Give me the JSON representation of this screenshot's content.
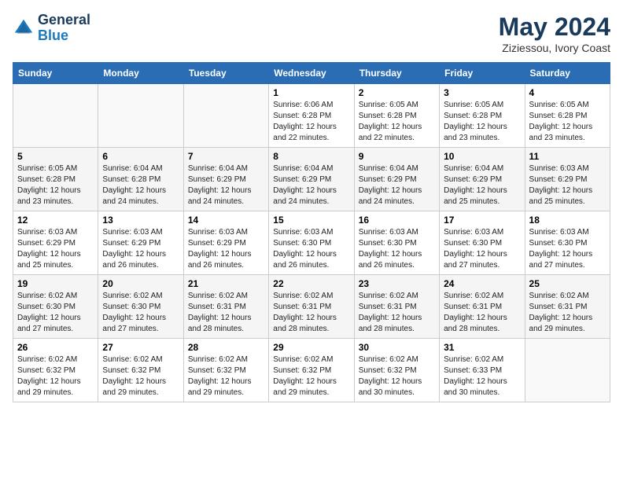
{
  "header": {
    "logo_line1": "General",
    "logo_line2": "Blue",
    "month": "May 2024",
    "location": "Ziziessou, Ivory Coast"
  },
  "weekdays": [
    "Sunday",
    "Monday",
    "Tuesday",
    "Wednesday",
    "Thursday",
    "Friday",
    "Saturday"
  ],
  "weeks": [
    [
      {
        "day": "",
        "info": ""
      },
      {
        "day": "",
        "info": ""
      },
      {
        "day": "",
        "info": ""
      },
      {
        "day": "1",
        "info": "Sunrise: 6:06 AM\nSunset: 6:28 PM\nDaylight: 12 hours\nand 22 minutes."
      },
      {
        "day": "2",
        "info": "Sunrise: 6:05 AM\nSunset: 6:28 PM\nDaylight: 12 hours\nand 22 minutes."
      },
      {
        "day": "3",
        "info": "Sunrise: 6:05 AM\nSunset: 6:28 PM\nDaylight: 12 hours\nand 23 minutes."
      },
      {
        "day": "4",
        "info": "Sunrise: 6:05 AM\nSunset: 6:28 PM\nDaylight: 12 hours\nand 23 minutes."
      }
    ],
    [
      {
        "day": "5",
        "info": "Sunrise: 6:05 AM\nSunset: 6:28 PM\nDaylight: 12 hours\nand 23 minutes."
      },
      {
        "day": "6",
        "info": "Sunrise: 6:04 AM\nSunset: 6:28 PM\nDaylight: 12 hours\nand 24 minutes."
      },
      {
        "day": "7",
        "info": "Sunrise: 6:04 AM\nSunset: 6:29 PM\nDaylight: 12 hours\nand 24 minutes."
      },
      {
        "day": "8",
        "info": "Sunrise: 6:04 AM\nSunset: 6:29 PM\nDaylight: 12 hours\nand 24 minutes."
      },
      {
        "day": "9",
        "info": "Sunrise: 6:04 AM\nSunset: 6:29 PM\nDaylight: 12 hours\nand 24 minutes."
      },
      {
        "day": "10",
        "info": "Sunrise: 6:04 AM\nSunset: 6:29 PM\nDaylight: 12 hours\nand 25 minutes."
      },
      {
        "day": "11",
        "info": "Sunrise: 6:03 AM\nSunset: 6:29 PM\nDaylight: 12 hours\nand 25 minutes."
      }
    ],
    [
      {
        "day": "12",
        "info": "Sunrise: 6:03 AM\nSunset: 6:29 PM\nDaylight: 12 hours\nand 25 minutes."
      },
      {
        "day": "13",
        "info": "Sunrise: 6:03 AM\nSunset: 6:29 PM\nDaylight: 12 hours\nand 26 minutes."
      },
      {
        "day": "14",
        "info": "Sunrise: 6:03 AM\nSunset: 6:29 PM\nDaylight: 12 hours\nand 26 minutes."
      },
      {
        "day": "15",
        "info": "Sunrise: 6:03 AM\nSunset: 6:30 PM\nDaylight: 12 hours\nand 26 minutes."
      },
      {
        "day": "16",
        "info": "Sunrise: 6:03 AM\nSunset: 6:30 PM\nDaylight: 12 hours\nand 26 minutes."
      },
      {
        "day": "17",
        "info": "Sunrise: 6:03 AM\nSunset: 6:30 PM\nDaylight: 12 hours\nand 27 minutes."
      },
      {
        "day": "18",
        "info": "Sunrise: 6:03 AM\nSunset: 6:30 PM\nDaylight: 12 hours\nand 27 minutes."
      }
    ],
    [
      {
        "day": "19",
        "info": "Sunrise: 6:02 AM\nSunset: 6:30 PM\nDaylight: 12 hours\nand 27 minutes."
      },
      {
        "day": "20",
        "info": "Sunrise: 6:02 AM\nSunset: 6:30 PM\nDaylight: 12 hours\nand 27 minutes."
      },
      {
        "day": "21",
        "info": "Sunrise: 6:02 AM\nSunset: 6:31 PM\nDaylight: 12 hours\nand 28 minutes."
      },
      {
        "day": "22",
        "info": "Sunrise: 6:02 AM\nSunset: 6:31 PM\nDaylight: 12 hours\nand 28 minutes."
      },
      {
        "day": "23",
        "info": "Sunrise: 6:02 AM\nSunset: 6:31 PM\nDaylight: 12 hours\nand 28 minutes."
      },
      {
        "day": "24",
        "info": "Sunrise: 6:02 AM\nSunset: 6:31 PM\nDaylight: 12 hours\nand 28 minutes."
      },
      {
        "day": "25",
        "info": "Sunrise: 6:02 AM\nSunset: 6:31 PM\nDaylight: 12 hours\nand 29 minutes."
      }
    ],
    [
      {
        "day": "26",
        "info": "Sunrise: 6:02 AM\nSunset: 6:32 PM\nDaylight: 12 hours\nand 29 minutes."
      },
      {
        "day": "27",
        "info": "Sunrise: 6:02 AM\nSunset: 6:32 PM\nDaylight: 12 hours\nand 29 minutes."
      },
      {
        "day": "28",
        "info": "Sunrise: 6:02 AM\nSunset: 6:32 PM\nDaylight: 12 hours\nand 29 minutes."
      },
      {
        "day": "29",
        "info": "Sunrise: 6:02 AM\nSunset: 6:32 PM\nDaylight: 12 hours\nand 29 minutes."
      },
      {
        "day": "30",
        "info": "Sunrise: 6:02 AM\nSunset: 6:32 PM\nDaylight: 12 hours\nand 30 minutes."
      },
      {
        "day": "31",
        "info": "Sunrise: 6:02 AM\nSunset: 6:33 PM\nDaylight: 12 hours\nand 30 minutes."
      },
      {
        "day": "",
        "info": ""
      }
    ]
  ]
}
